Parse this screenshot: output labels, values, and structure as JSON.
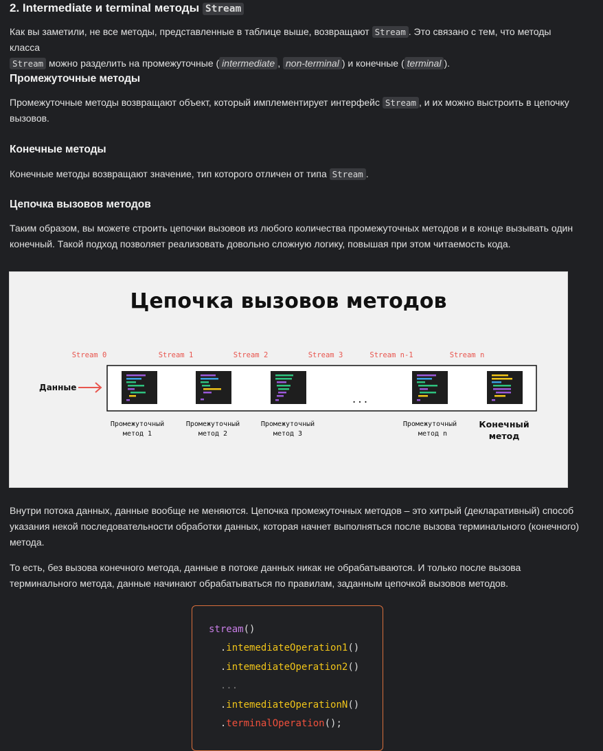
{
  "heading": {
    "text": "2. Intermediate и terminal методы",
    "code": "Stream"
  },
  "p1": {
    "t1": "Как вы заметили, не все методы, представленные в таблице выше, возвращают ",
    "c1": "Stream",
    "t2": ". Это связано с тем, что методы класса",
    "c2": "Stream",
    "t3": " можно разделить на промежуточные (",
    "c3": "intermediate",
    "t4": ", ",
    "c4": "non-terminal",
    "t5": ") и конечные (",
    "c5": "terminal",
    "t6": ")."
  },
  "h_intermediate": "Промежуточные методы",
  "p2": {
    "t1": "Промежуточные методы возвращают объект, который имплементирует интерфейс ",
    "c1": "Stream",
    "t2": ", и их можно выстроить в цепочку вызовов."
  },
  "h_terminal": "Конечные методы",
  "p3": {
    "t1": "Конечные методы возвращают значение, тип которого отличен от типа ",
    "c1": "Stream",
    "t2": "."
  },
  "h_chain": "Цепочка вызовов методов",
  "p4": "Таким образом, вы можете строить цепочки вызовов из любого количества промежуточных методов и в конце вызывать один конечный. Такой подход позволяет реализовать довольно сложную логику, повышая при этом читаемость кода.",
  "figure": {
    "title": "Цепочка вызовов методов",
    "input_label": "Данные",
    "streams": [
      "Stream 0",
      "Stream 1",
      "Stream 2",
      "Stream 3",
      "Stream n-1",
      "Stream n"
    ],
    "ellipsis": "...",
    "method_line1": "Промежуточный",
    "captions_line2": [
      "метод 1",
      "метод 2",
      "метод 3",
      "метод n"
    ],
    "terminal_line1": "Конечный",
    "terminal_line2": "метод",
    "colors": {
      "stream_label": "#e8554e",
      "arrow": "#e8554e",
      "box": "#1e1e1e"
    }
  },
  "p5": "Внутри потока данных, данные вообще не меняются. Цепочка промежуточных методов – это хитрый (декларативный) способ указания некой последовательности обработки данных, которая начнет выполняться после вызова терминального (конечного) метода.",
  "p6": "То есть, без вызова конечного метода, данные в потоке данных никак не обрабатываются. И только после вызова терминального метода, данные начинают обрабатываться по правилам, заданным цепочкой вызовов методов.",
  "code": {
    "l1_kw": "stream",
    "l1_rest": "()",
    "l2_dot": ".",
    "l2_fn": "intemediateOperation1",
    "l2_rest": "()",
    "l3_dot": ".",
    "l3_fn": "intemediateOperation2",
    "l3_rest": "()",
    "l4": "...",
    "l5_dot": ".",
    "l5_fn": "intemediateOperationN",
    "l5_rest": "()",
    "l6_dot": ".",
    "l6_fn": "terminalOperation",
    "l6_rest": "();"
  }
}
